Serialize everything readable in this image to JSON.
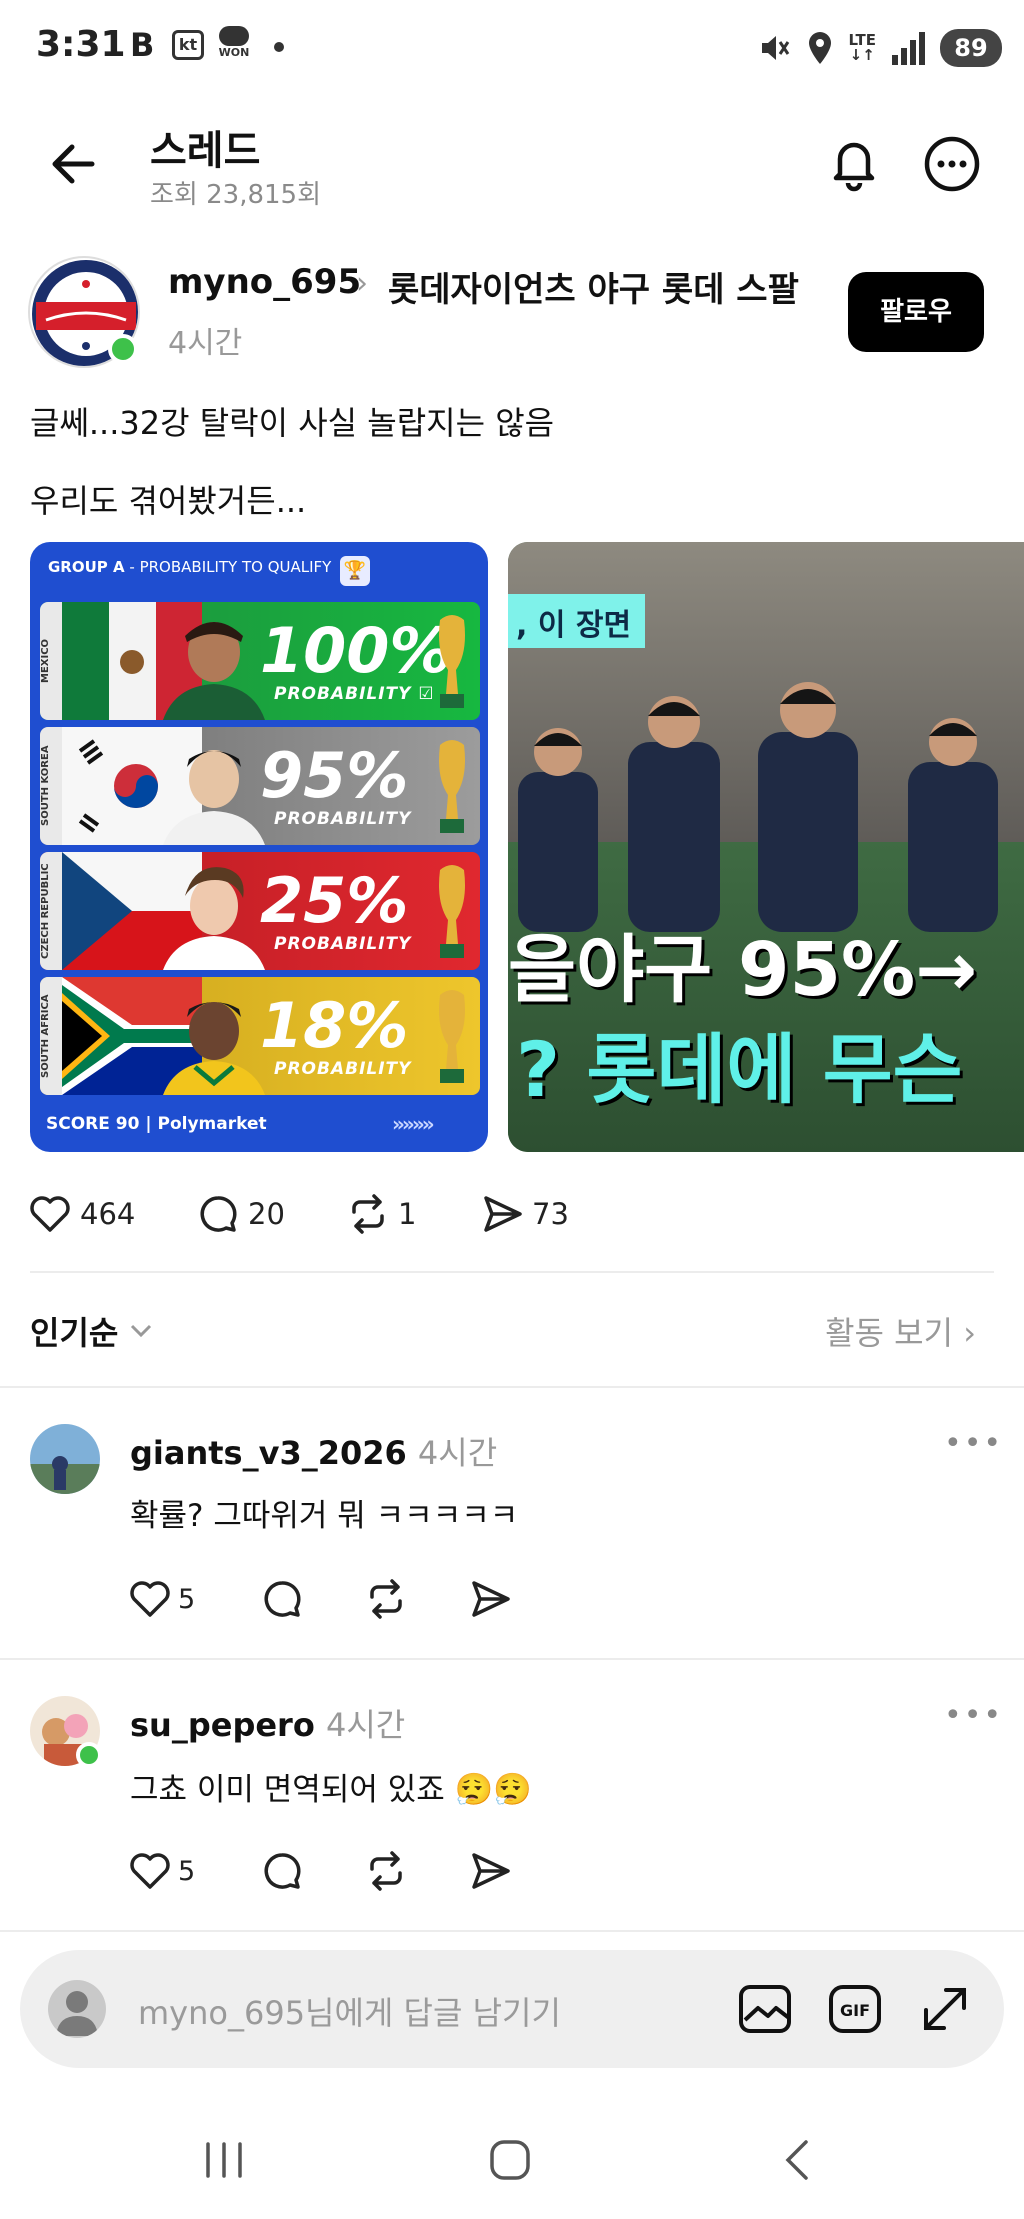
{
  "status_bar": {
    "time": "3:31",
    "carrier_b": "B",
    "carrier_kt": "kt",
    "won_label": "WON",
    "network": "LTE",
    "battery": "89"
  },
  "header": {
    "title": "스레드",
    "views": "조회 23,815회"
  },
  "post": {
    "username": "myno_695",
    "community": "롯데자이언츠 야구 롯데 스팔",
    "time": "4시간",
    "follow_label": "팔로우",
    "text_line1": "글쎄...32강 탈락이 사실 놀랍지는 않음",
    "text_line2": "우리도 겪어봤거든...",
    "image1": {
      "header_bold": "GROUP A",
      "header_rest": " - PROBABILITY TO QUALIFY",
      "rows": [
        {
          "country": "MEXICO",
          "percent": "100%",
          "caption": "PROBABILITY ☑"
        },
        {
          "country": "SOUTH KOREA",
          "percent": "95%",
          "caption": "PROBABILITY"
        },
        {
          "country": "CZECH REPUBLIC",
          "percent": "25%",
          "caption": "PROBABILITY"
        },
        {
          "country": "SOUTH AFRICA",
          "percent": "18%",
          "caption": "PROBABILITY"
        }
      ],
      "footer": "SCORE 90  |  Polymarket",
      "arrows": "»»»»"
    },
    "image2": {
      "tag": ", 이 장면",
      "line1": "을야구 95%→",
      "line2": "? 롯데에 무슨"
    },
    "likes": "464",
    "comments": "20",
    "reposts": "1",
    "shares": "73"
  },
  "sort": {
    "label": "인기순",
    "activity_label": "활동 보기 ›"
  },
  "comments": [
    {
      "username": "giants_v3_2026",
      "time": "4시간",
      "text": "확률? 그따위거 뭐 ㅋㅋㅋㅋㅋ",
      "likes": "5"
    },
    {
      "username": "su_pepero",
      "time": "4시간",
      "text": "그쵸 이미 면역되어 있죠 😮‍💨😮‍💨",
      "likes": "5"
    }
  ],
  "reply": {
    "placeholder": "myno_695님에게 답글 남기기"
  },
  "colors": {
    "accent_black": "#000000",
    "online_green": "#3ec14a",
    "muted_gray": "#999999"
  }
}
